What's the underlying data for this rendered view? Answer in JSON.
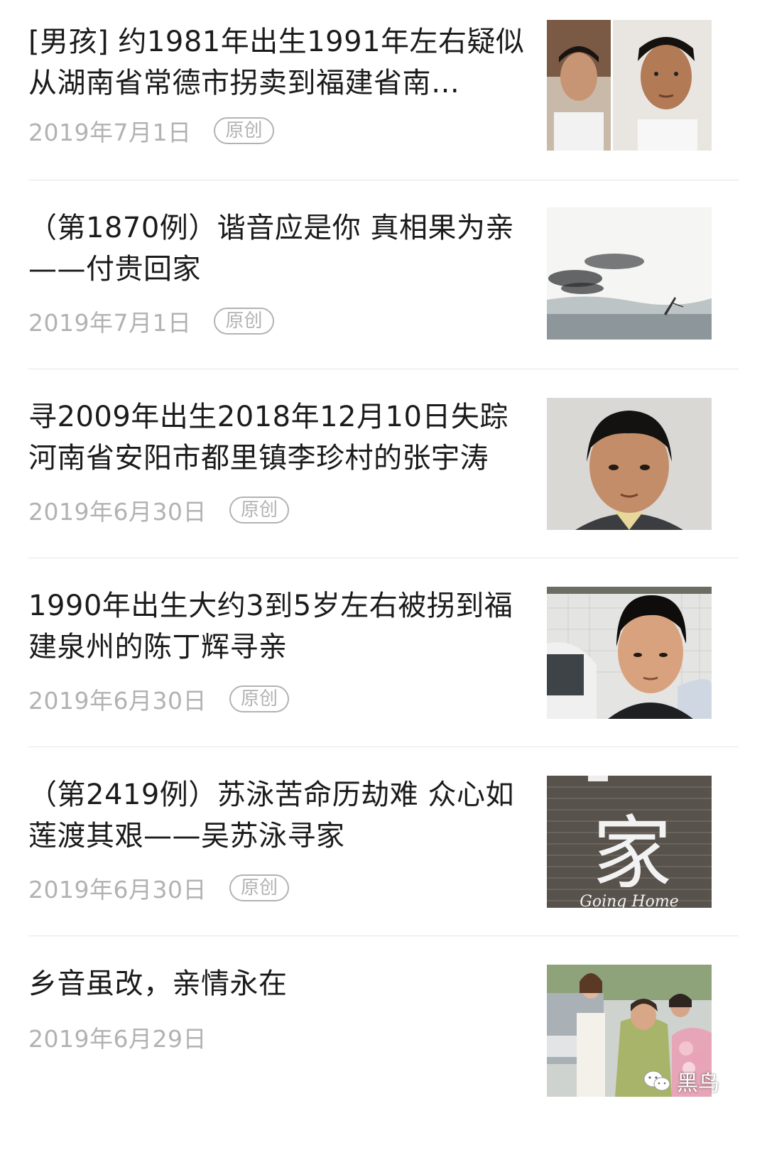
{
  "articles": [
    {
      "title": "[男孩] 约1981年出生1991年左右疑似从湖南省常德市拐卖到福建省南…",
      "date": "2019年7月1日",
      "badge": "原创",
      "thumb_icon": "two-man-portraits-photo"
    },
    {
      "title": "（第1870例）谐音应是你 真相果为亲——付贵回家",
      "date": "2019年7月1日",
      "badge": "原创",
      "thumb_icon": "ink-landscape-painting"
    },
    {
      "title": "寻2009年出生2018年12月10日失踪河南省安阳市都里镇李珍村的张宇涛",
      "date": "2019年6月30日",
      "badge": "原创",
      "thumb_icon": "boy-portrait-photo"
    },
    {
      "title": "1990年出生大约3到5岁左右被拐到福建泉州的陈丁辉寻亲",
      "date": "2019年6月30日",
      "badge": "原创",
      "thumb_icon": "young-man-selfie-photo"
    },
    {
      "title": "（第2419例）苏泳苦命历劫难 众心如莲渡其艰——吴苏泳寻家",
      "date": "2019年6月30日",
      "badge": "原创",
      "thumb_icon": "going-home-poster"
    },
    {
      "title": "乡音虽改，亲情永在",
      "date": "2019年6月29日",
      "badge": "",
      "thumb_icon": "family-reunion-photo"
    }
  ],
  "thumb_text": {
    "poster_big_char": "家",
    "poster_english": "Going Home"
  },
  "watermark": {
    "label": "黑鸟",
    "icon": "wechat-icon"
  },
  "colors": {
    "title": "#1b1b1b",
    "meta": "#b2b2b2",
    "divider": "#e6e6e6"
  }
}
